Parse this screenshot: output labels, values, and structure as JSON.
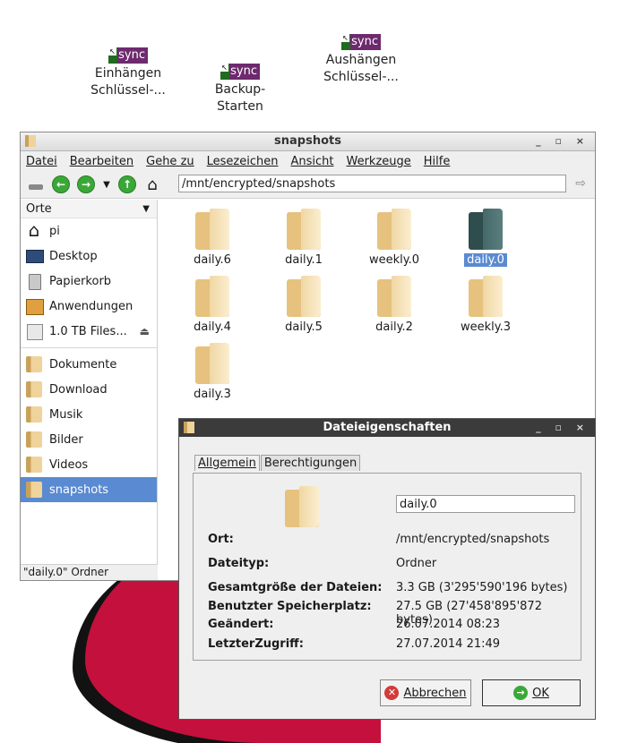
{
  "desktop": {
    "icons": [
      {
        "badge": "sync",
        "label": "Einhängen\nSchlüssel-..."
      },
      {
        "badge": "sync",
        "label": "Backup-\nStarten"
      },
      {
        "badge": "sync",
        "label": "Aushängen\nSchlüssel-..."
      }
    ]
  },
  "window": {
    "title": "snapshots",
    "menu": [
      "Datei",
      "Bearbeiten",
      "Gehe zu",
      "Lesezeichen",
      "Ansicht",
      "Werkzeuge",
      "Hilfe"
    ],
    "address": "/mnt/encrypted/snapshots",
    "sidebar": {
      "header": "Orte",
      "places": [
        {
          "label": "pi",
          "icon": "home-icon"
        },
        {
          "label": "Desktop",
          "icon": "desktop-icon"
        },
        {
          "label": "Papierkorb",
          "icon": "trash-icon"
        },
        {
          "label": "Anwendungen",
          "icon": "applications-icon"
        },
        {
          "label": "1.0 TB Files...",
          "icon": "drive-icon"
        }
      ],
      "bookmarks": [
        {
          "label": "Dokumente"
        },
        {
          "label": "Download"
        },
        {
          "label": "Musik"
        },
        {
          "label": "Bilder"
        },
        {
          "label": "Videos"
        },
        {
          "label": "snapshots",
          "selected": true
        }
      ]
    },
    "files": [
      {
        "name": "daily.6"
      },
      {
        "name": "daily.1"
      },
      {
        "name": "weekly.0"
      },
      {
        "name": "daily.0",
        "selected": true
      },
      {
        "name": "daily.4"
      },
      {
        "name": "daily.5"
      },
      {
        "name": "daily.2"
      },
      {
        "name": "weekly.3"
      },
      {
        "name": "daily.3"
      }
    ],
    "status": "\"daily.0\" Ordner"
  },
  "dialog": {
    "title": "Dateieigenschaften",
    "tabs": [
      "Allgemein",
      "Berechtigungen"
    ],
    "name_value": "daily.0",
    "rows": [
      {
        "label": "Ort:",
        "value": "/mnt/encrypted/snapshots"
      },
      {
        "label": "Dateityp:",
        "value": "Ordner"
      },
      {
        "label": "Gesamtgröße der Dateien:",
        "value": "3.3 GB (3'295'590'196 bytes)"
      },
      {
        "label": "Benutzter Speicherplatz:",
        "value": "27.5 GB (27'458'895'872 bytes)"
      },
      {
        "label": "Geändert:",
        "value": "26.07.2014 08:23"
      },
      {
        "label": "LetzterZugriff:",
        "value": "27.07.2014 21:49"
      }
    ],
    "cancel_label": "Abbrechen",
    "ok_label": "OK"
  }
}
